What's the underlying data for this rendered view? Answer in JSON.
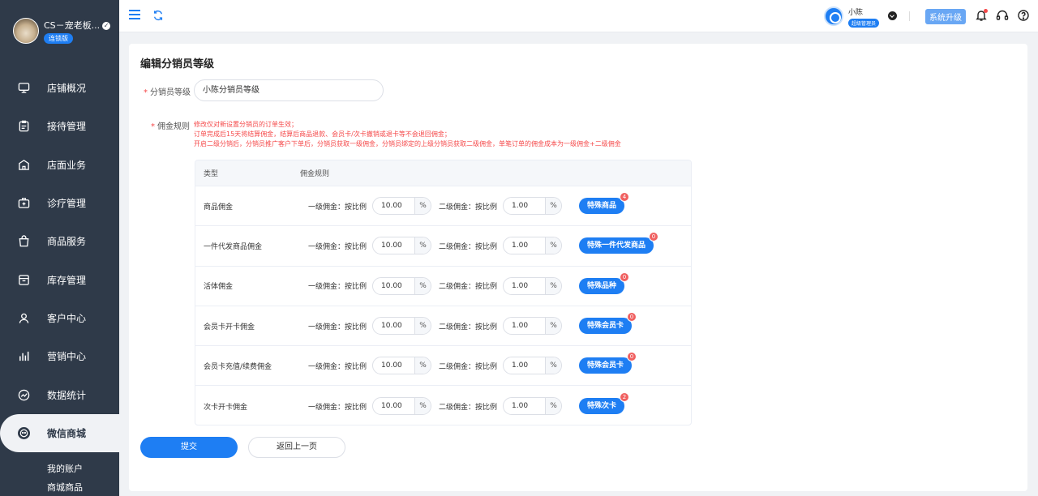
{
  "sidebar": {
    "shop_name": "CS－宠老板...",
    "shop_badge": "连锁版",
    "items": [
      {
        "label": "店铺概况",
        "icon": "monitor-icon"
      },
      {
        "label": "接待管理",
        "icon": "clipboard-icon"
      },
      {
        "label": "店面业务",
        "icon": "store-icon"
      },
      {
        "label": "诊疗管理",
        "icon": "medical-kit-icon"
      },
      {
        "label": "商品服务",
        "icon": "bag-icon"
      },
      {
        "label": "库存管理",
        "icon": "inventory-icon"
      },
      {
        "label": "客户中心",
        "icon": "user-icon"
      },
      {
        "label": "营销中心",
        "icon": "bar-chart-icon"
      },
      {
        "label": "数据统计",
        "icon": "trend-icon"
      },
      {
        "label": "微信商城",
        "icon": "wechat-icon",
        "active": true
      }
    ],
    "sub_items": [
      "我的账户",
      "商城商品"
    ]
  },
  "header": {
    "user_name": "小陈",
    "user_role": "超级管理员",
    "upgrade_label": "系统升级"
  },
  "page": {
    "title": "编辑分销员等级",
    "level_label": "分销员等级",
    "level_value": "小陈分销员等级",
    "rules_label": "佣金规则",
    "rules_notes": [
      "修改仅对新设置分销员的订单生效；",
      "订单完成后15天将结算佣金，结算后商品退款、会员卡/次卡撤销或退卡等不会退回佣金；",
      "开启二级分销后，分销员推广客户下单后，分销员获取一级佣金，分销员绑定的上级分销员获取二级佣金，单笔订单的佣金成本为一级佣金+二级佣金"
    ]
  },
  "table": {
    "headers": [
      "类型",
      "佣金规则"
    ],
    "level1_label": "一级佣金：按比例",
    "level2_label": "二级佣金：按比例",
    "unit": "%",
    "rows": [
      {
        "type": "商品佣金",
        "l1": "10.00",
        "l2": "1.00",
        "button": "特殊商品",
        "count": "4"
      },
      {
        "type": "一件代发商品佣金",
        "l1": "10.00",
        "l2": "1.00",
        "button": "特殊一件代发商品",
        "count": "0"
      },
      {
        "type": "活体佣金",
        "l1": "10.00",
        "l2": "1.00",
        "button": "特殊品种",
        "count": "0"
      },
      {
        "type": "会员卡开卡佣金",
        "l1": "10.00",
        "l2": "1.00",
        "button": "特殊会员卡",
        "count": "0"
      },
      {
        "type": "会员卡充值/续费佣金",
        "l1": "10.00",
        "l2": "1.00",
        "button": "特殊会员卡",
        "count": "0"
      },
      {
        "type": "次卡开卡佣金",
        "l1": "10.00",
        "l2": "1.00",
        "button": "特殊次卡",
        "count": "2"
      }
    ]
  },
  "actions": {
    "submit_label": "提交",
    "back_label": "返回上一页"
  },
  "colors": {
    "primary": "#1e7ef3",
    "sidebar_bg": "#2f3a49",
    "danger": "#f5494a"
  }
}
